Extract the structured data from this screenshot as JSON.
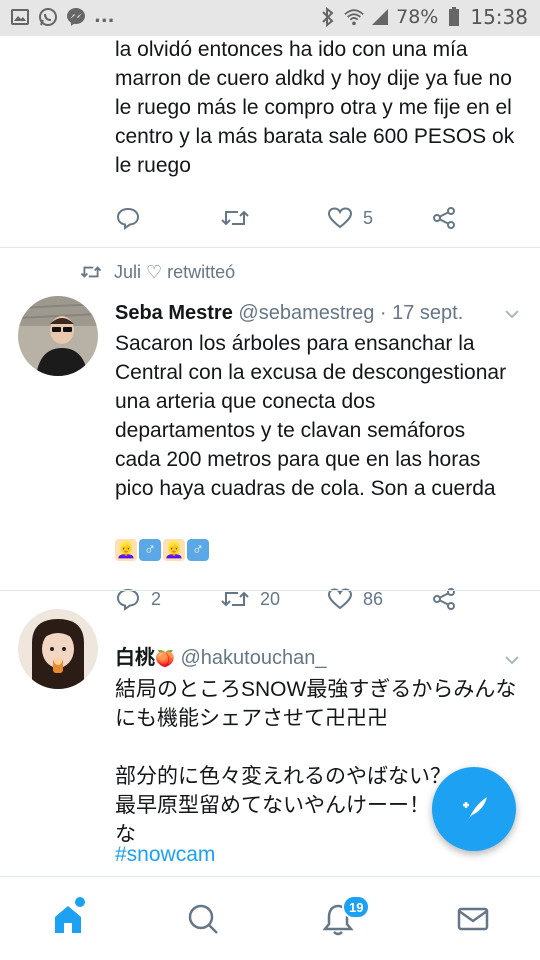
{
  "status_bar": {
    "battery_percent": "78%",
    "time": "15:38",
    "overflow_dots": "..."
  },
  "tweets": [
    {
      "text": "la olvidó entonces ha ido con una mía\nmarron de cuero aldkd y hoy dije ya fue no\nle ruego más le compro otra y me fije en el\ncentro y la más barata sale 600 PESOS ok\nle ruego",
      "reply_count": "",
      "retweet_count": "",
      "like_count": "5"
    },
    {
      "retweeted_by": "Juli ♡ retwitteó",
      "name": "Seba Mestre",
      "handle": "@sebamestreg",
      "separator": "·",
      "date": "17 sept.",
      "text": "Sacaron los árboles para ensanchar la\nCentral con la excusa de descongestionar\nuna arteria que conecta dos\ndepartamentos y te clavan semáforos\ncada 200 metros para que en las horas\npico haya cuadras de cola. Son a cuerda",
      "emojis": [
        "👱‍♀️",
        "♂",
        "👱‍♀️",
        "♂"
      ],
      "reply_count": "2",
      "retweet_count": "20",
      "like_count": "86"
    },
    {
      "name": "白桃",
      "name_emoji": "🍑",
      "handle": "@hakutouchan_",
      "text": "結局のところSNOW最強すぎるからみんな\nにも機能シェアさせて卍卍卍\n\n部分的に色々変えれるのやばない？\n最早原型留めてないやんけーー！！！って\nな",
      "hashtag": "#snowcam"
    }
  ],
  "bottom_nav": {
    "notifications_badge": "19"
  },
  "colors": {
    "accent": "#1da1f2",
    "text": "#14171a",
    "secondary": "#657786",
    "divider": "#e1e8ed"
  }
}
